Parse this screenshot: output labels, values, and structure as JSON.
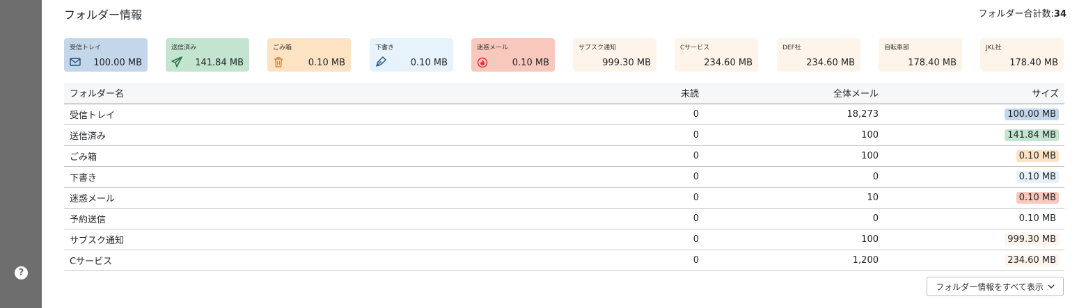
{
  "help_icon_label": "?",
  "header": {
    "title": "フォルダー情報",
    "total_label": "フォルダー合計数:",
    "total_value": "34"
  },
  "cards": [
    {
      "label": "受信トレイ",
      "value": "100.00 MB",
      "icon": "inbox-icon",
      "bg": "#c4d7ea"
    },
    {
      "label": "送信済み",
      "value": "141.84 MB",
      "icon": "send-icon",
      "bg": "#c3e4cf"
    },
    {
      "label": "ごみ箱",
      "value": "0.10 MB",
      "icon": "trash-icon",
      "bg": "#fde2c3"
    },
    {
      "label": "下書き",
      "value": "0.10 MB",
      "icon": "pen-icon",
      "bg": "#e6f3fc"
    },
    {
      "label": "迷惑メール",
      "value": "0.10 MB",
      "icon": "fire-icon",
      "bg": "#f8c8bd"
    },
    {
      "label": "サブスク通知",
      "value": "999.30 MB",
      "icon": "",
      "bg": "#fff4ea"
    },
    {
      "label": "Cサービス",
      "value": "234.60 MB",
      "icon": "",
      "bg": "#fff4ea"
    },
    {
      "label": "DEF社",
      "value": "234.60 MB",
      "icon": "",
      "bg": "#fff4ea"
    },
    {
      "label": "自転車部",
      "value": "178.40 MB",
      "icon": "",
      "bg": "#fff4ea"
    },
    {
      "label": "JKL社",
      "value": "178.40 MB",
      "icon": "",
      "bg": "#fff4ea"
    }
  ],
  "table": {
    "columns": [
      "フォルダー名",
      "未読",
      "全体メール",
      "サイズ"
    ],
    "rows": [
      {
        "name": "受信トレイ",
        "unread": "0",
        "total": "18,273",
        "size": "100.00 MB",
        "size_bg": "#c4d7ea"
      },
      {
        "name": "送信済み",
        "unread": "0",
        "total": "100",
        "size": "141.84 MB",
        "size_bg": "#c3e4cf"
      },
      {
        "name": "ごみ箱",
        "unread": "0",
        "total": "100",
        "size": "0.10 MB",
        "size_bg": "#fde2c3"
      },
      {
        "name": "下書き",
        "unread": "0",
        "total": "0",
        "size": "0.10 MB",
        "size_bg": "#e6f3fc"
      },
      {
        "name": "迷惑メール",
        "unread": "0",
        "total": "10",
        "size": "0.10 MB",
        "size_bg": "#f8c8bd"
      },
      {
        "name": "予約送信",
        "unread": "0",
        "total": "0",
        "size": "0.10 MB",
        "size_bg": ""
      },
      {
        "name": "サブスク通知",
        "unread": "0",
        "total": "100",
        "size": "999.30 MB",
        "size_bg": "#fff4ea"
      },
      {
        "name": "Cサービス",
        "unread": "0",
        "total": "1,200",
        "size": "234.60 MB",
        "size_bg": "#fff4ea"
      }
    ]
  },
  "show_all_button": {
    "label": "フォルダー情報をすべて表示",
    "icon": "chevron-down-icon"
  }
}
